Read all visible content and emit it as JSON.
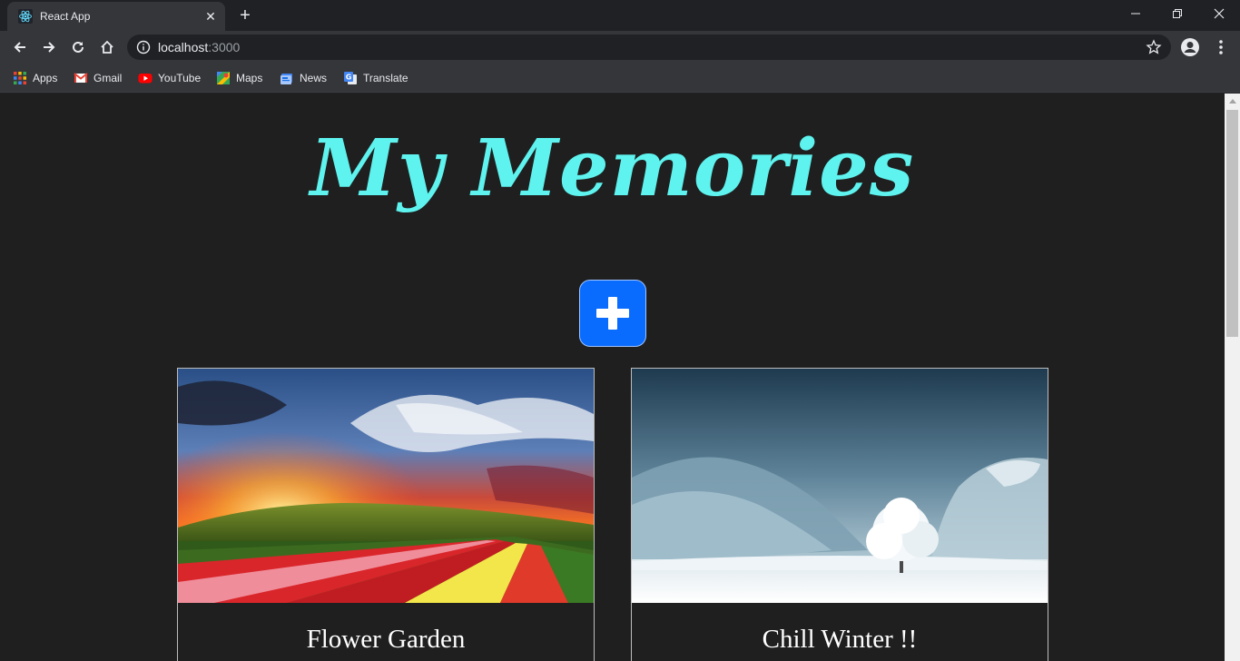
{
  "browser": {
    "tab_title": "React App",
    "url_host": "localhost",
    "url_port": ":3000",
    "bookmarks": [
      {
        "label": "Apps",
        "icon": "apps-grid-icon"
      },
      {
        "label": "Gmail",
        "icon": "gmail-icon"
      },
      {
        "label": "YouTube",
        "icon": "youtube-icon"
      },
      {
        "label": "Maps",
        "icon": "maps-icon"
      },
      {
        "label": "News",
        "icon": "news-icon"
      },
      {
        "label": "Translate",
        "icon": "translate-icon"
      }
    ]
  },
  "page": {
    "title": "My Memories",
    "title_color": "#5ef3ee",
    "add_button_icon": "plus-icon",
    "add_button_color": "#0a6cff",
    "memories": [
      {
        "title": "Flower Garden",
        "image": "flower-field-sunset-image"
      },
      {
        "title": "Chill Winter !!",
        "image": "snowy-tree-winter-image"
      }
    ]
  }
}
